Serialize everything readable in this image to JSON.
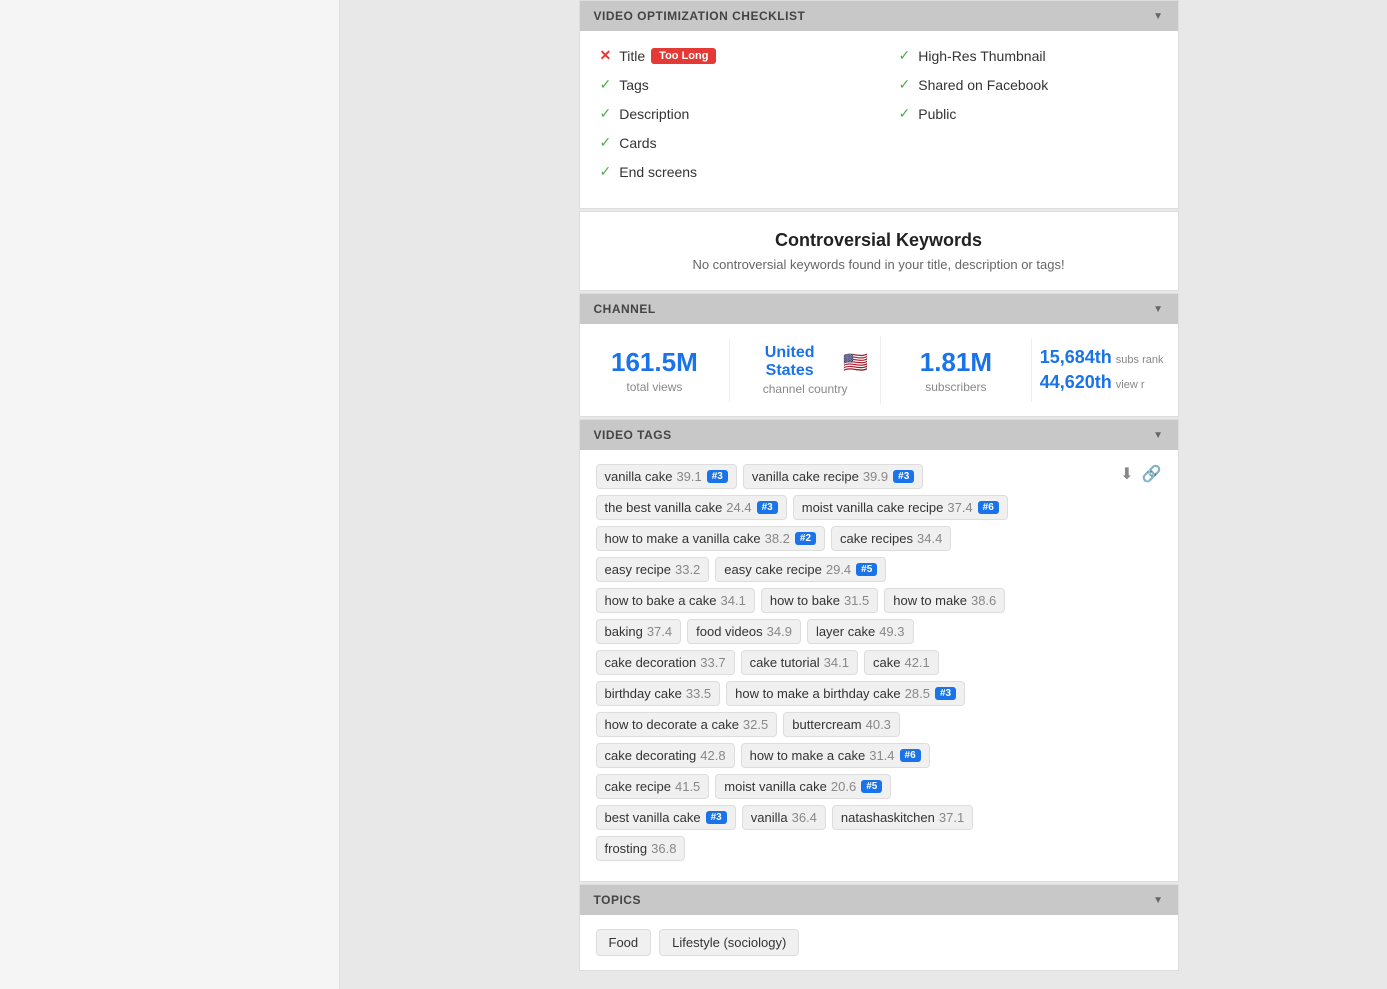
{
  "leftPanel": {
    "visible": true
  },
  "checklist": {
    "header": "VIDEO OPTIMIZATION CHECKLIST",
    "items_left": [
      {
        "status": "x",
        "label": "Title",
        "badge": "Too Long"
      },
      {
        "status": "check",
        "label": "Tags",
        "badge": null
      },
      {
        "status": "check",
        "label": "Description",
        "badge": null
      },
      {
        "status": "check",
        "label": "Cards",
        "badge": null
      },
      {
        "status": "check",
        "label": "End screens",
        "badge": null
      }
    ],
    "items_right": [
      {
        "status": "check",
        "label": "High-Res Thumbnail",
        "badge": null
      },
      {
        "status": "check",
        "label": "Shared on Facebook",
        "badge": null
      },
      {
        "status": "check",
        "label": "Public",
        "badge": null
      }
    ]
  },
  "controversial": {
    "title": "Controversial Keywords",
    "subtitle": "No controversial keywords found in your title, description or tags!"
  },
  "channel": {
    "header": "CHANNEL",
    "total_views": "161.5M",
    "total_views_label": "total views",
    "country": "United States",
    "country_label": "channel country",
    "flag": "🇺🇸",
    "subscribers": "1.81M",
    "subscribers_label": "subscribers",
    "subs_rank": "15,684th",
    "subs_rank_label": "subs rank",
    "view_rank": "44,620th",
    "view_rank_label": "view r"
  },
  "video_tags": {
    "header": "VIDEO TAGS",
    "tags": [
      {
        "name": "vanilla cake",
        "score": "39.1",
        "badge": "#3"
      },
      {
        "name": "vanilla cake recipe",
        "score": "39.9",
        "badge": "#3"
      },
      {
        "name": "the best vanilla cake",
        "score": "24.4",
        "badge": "#3"
      },
      {
        "name": "moist vanilla cake recipe",
        "score": "37.4",
        "badge": "#6"
      },
      {
        "name": "how to make a vanilla cake",
        "score": "38.2",
        "badge": "#2"
      },
      {
        "name": "cake recipes",
        "score": "34.4",
        "badge": null
      },
      {
        "name": "easy recipe",
        "score": "33.2",
        "badge": null
      },
      {
        "name": "easy cake recipe",
        "score": "29.4",
        "badge": "#5"
      },
      {
        "name": "how to bake a cake",
        "score": "34.1",
        "badge": null
      },
      {
        "name": "how to bake",
        "score": "31.5",
        "badge": null
      },
      {
        "name": "how to make",
        "score": "38.6",
        "badge": null
      },
      {
        "name": "baking",
        "score": "37.4",
        "badge": null
      },
      {
        "name": "food videos",
        "score": "34.9",
        "badge": null
      },
      {
        "name": "layer cake",
        "score": "49.3",
        "badge": null
      },
      {
        "name": "cake decoration",
        "score": "33.7",
        "badge": null
      },
      {
        "name": "cake tutorial",
        "score": "34.1",
        "badge": null
      },
      {
        "name": "cake",
        "score": "42.1",
        "badge": null
      },
      {
        "name": "birthday cake",
        "score": "33.5",
        "badge": null
      },
      {
        "name": "how to make a birthday cake",
        "score": "28.5",
        "badge": "#3"
      },
      {
        "name": "how to decorate a cake",
        "score": "32.5",
        "badge": null
      },
      {
        "name": "buttercream",
        "score": "40.3",
        "badge": null
      },
      {
        "name": "cake decorating",
        "score": "42.8",
        "badge": null
      },
      {
        "name": "how to make a cake",
        "score": "31.4",
        "badge": "#6"
      },
      {
        "name": "cake recipe",
        "score": "41.5",
        "badge": null
      },
      {
        "name": "moist vanilla cake",
        "score": "20.6",
        "badge": "#5"
      },
      {
        "name": "best vanilla cake",
        "score": null,
        "badge": "#3"
      },
      {
        "name": "vanilla",
        "score": "36.4",
        "badge": null
      },
      {
        "name": "natashaskitchen",
        "score": "37.1",
        "badge": null
      },
      {
        "name": "frosting",
        "score": "36.8",
        "badge": null
      }
    ]
  },
  "topics": {
    "header": "TOPICS",
    "items": [
      "Food",
      "Lifestyle (sociology)"
    ]
  }
}
